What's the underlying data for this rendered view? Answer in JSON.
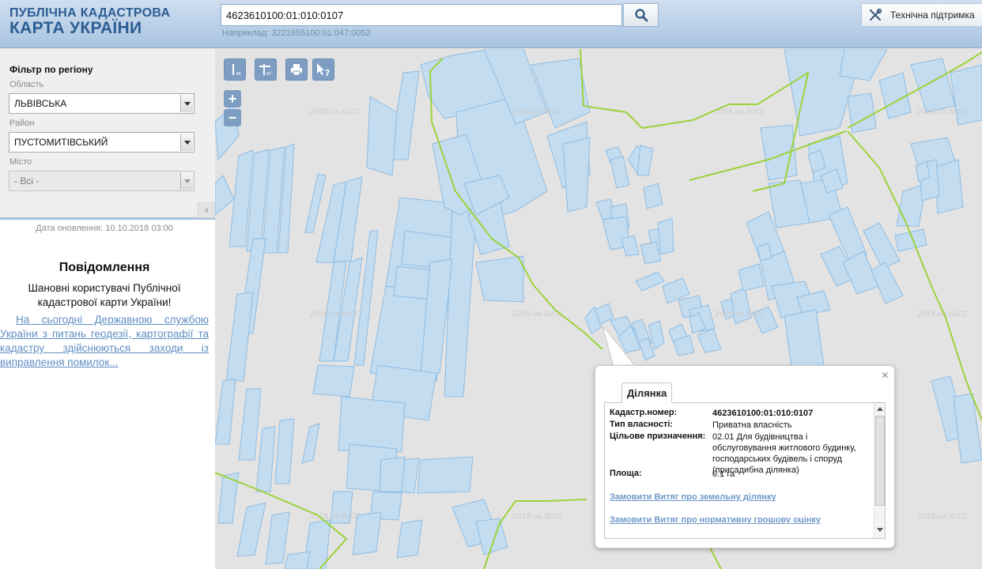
{
  "header": {
    "logo_line1": "ПУБЛІЧНА КАДАСТРОВА",
    "logo_line2": "КАРТА УКРАЇНИ",
    "search_value": "4623610100:01:010:0107",
    "search_hint": "Наприклад: 3221655100:01:047:0052",
    "support_label": "Технічна підтримка"
  },
  "sidebar": {
    "filter_title": "Фільтр по регіону",
    "oblast_label": "Область",
    "oblast_value": "ЛЬВІВСЬКА",
    "rayon_label": "Район",
    "rayon_value": "ПУСТОМИТІВСЬКИЙ",
    "misto_label": "Місто",
    "misto_value": "- Всі -",
    "update_date": "Дата оновлення: 10.10.2018 03:00",
    "news_title": "Повідомлення",
    "news_greeting": "Шановні користувачі Публічної кадастрової карти України!",
    "news_link": "На сьогодні Державною службою України з питань геодезії, картографії та кадастру здійснюються заходи із виправлення помилок..."
  },
  "map": {
    "watermark": "2018.ua.SLCC",
    "toolbar": {
      "distance_sub": "м",
      "area_sub": "м²"
    },
    "zoom_in": "+",
    "zoom_out": "−"
  },
  "popup": {
    "close": "×",
    "tab_label": "Ділянка",
    "cadastral_label": "Кадастр.номер:",
    "cadastral_value": "4623610100:01:010:0107",
    "ownership_label": "Тип власності:",
    "ownership_value": "Приватна власність",
    "purpose_label": "Цільове призначення:",
    "purpose_value": "02.01 Для будівництва і обслуговування житлового будинку, господарських будівель і споруд (присадибна ділянка)",
    "area_label": "Площа:",
    "area_value": "0.1 га",
    "link_extract": "Замовити Витяг про земельну ділянку",
    "link_valuation": "Замовити Витяг про нормативну грошову оцінку"
  },
  "colors": {
    "parcel_fill": "#c3dcf0",
    "parcel_stroke": "#8fbde3",
    "boundary": "#9bd33a",
    "header": "#b9d0e8",
    "tool": "#7d9ec2"
  }
}
